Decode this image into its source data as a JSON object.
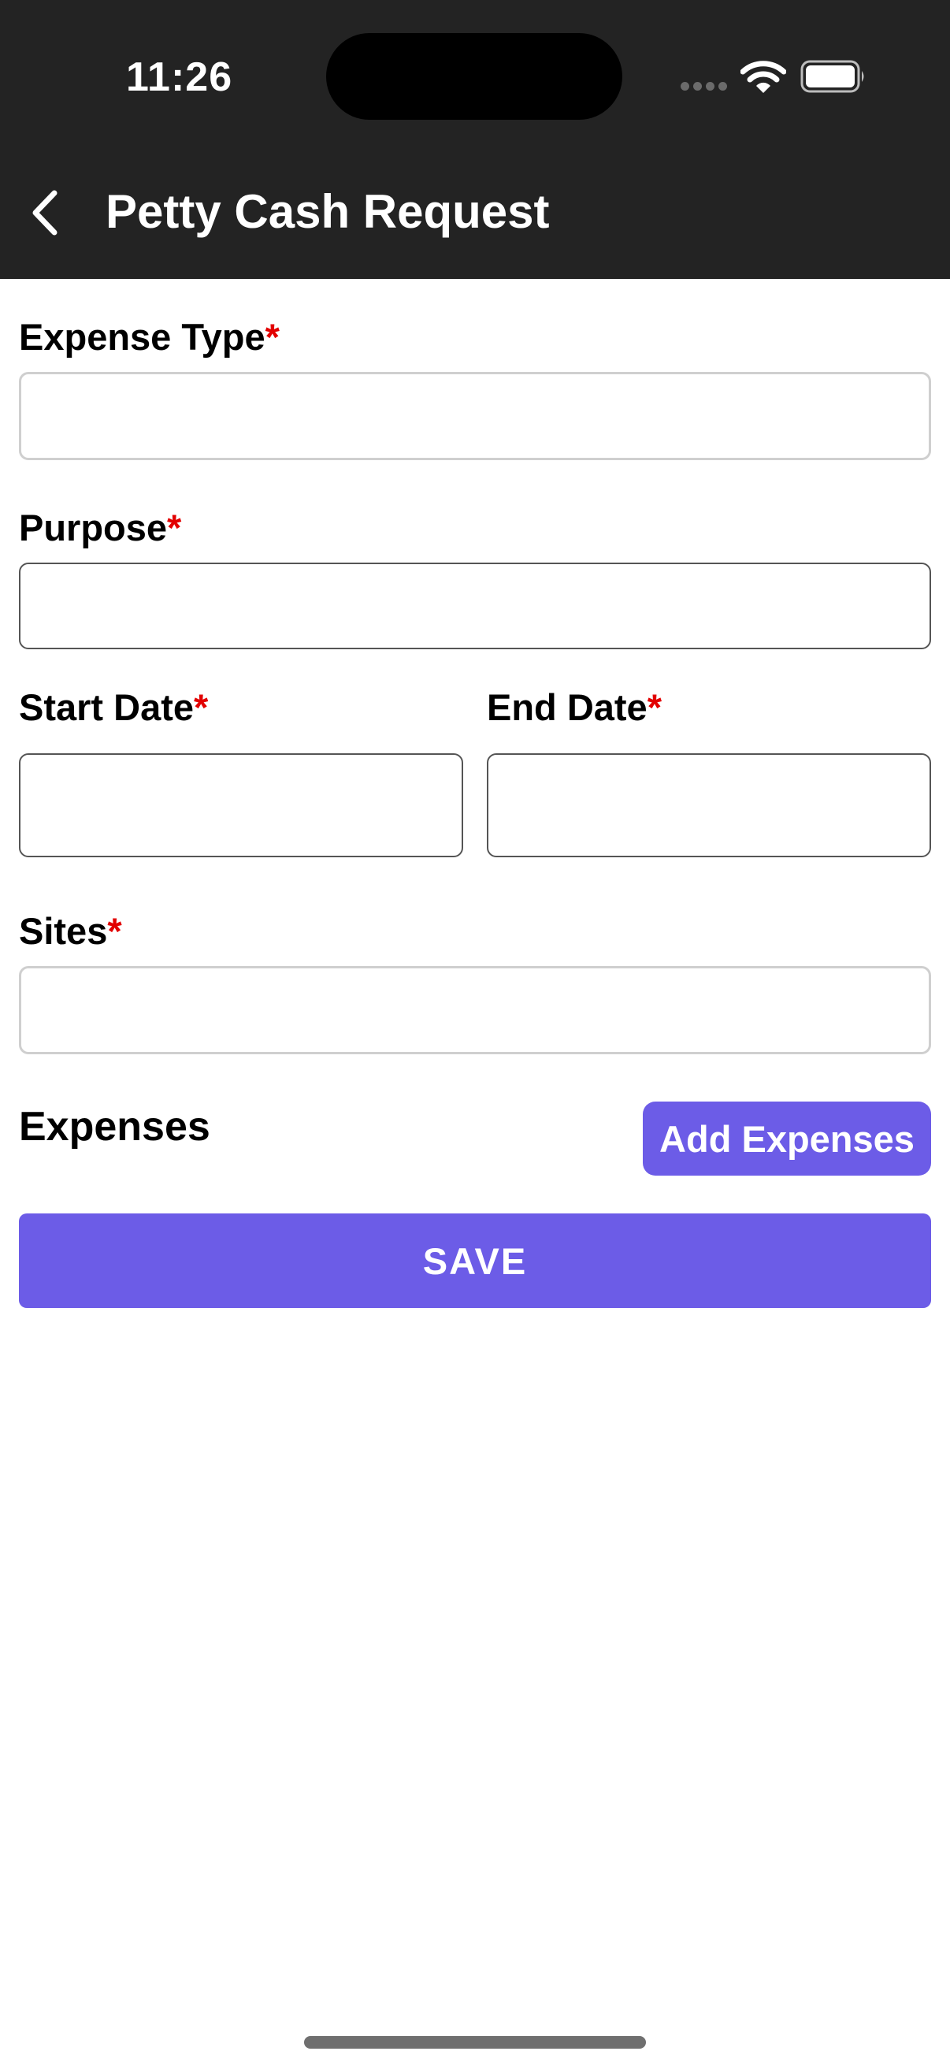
{
  "status_bar": {
    "time": "11:26"
  },
  "header": {
    "title": "Petty Cash Request",
    "back_icon": "chevron-left-icon"
  },
  "form": {
    "expense_type": {
      "label": "Expense Type",
      "required_mark": "*",
      "value": ""
    },
    "purpose": {
      "label": "Purpose",
      "required_mark": "*",
      "value": ""
    },
    "start_date": {
      "label": "Start Date",
      "required_mark": "*",
      "value": ""
    },
    "end_date": {
      "label": "End Date",
      "required_mark": "*",
      "value": ""
    },
    "sites": {
      "label": "Sites",
      "required_mark": "*",
      "value": ""
    }
  },
  "expenses": {
    "title": "Expenses",
    "add_button": "Add Expenses"
  },
  "save_button": "SAVE",
  "colors": {
    "header_bg": "#232323",
    "accent": "#6c5ce7",
    "required": "#e20000"
  }
}
